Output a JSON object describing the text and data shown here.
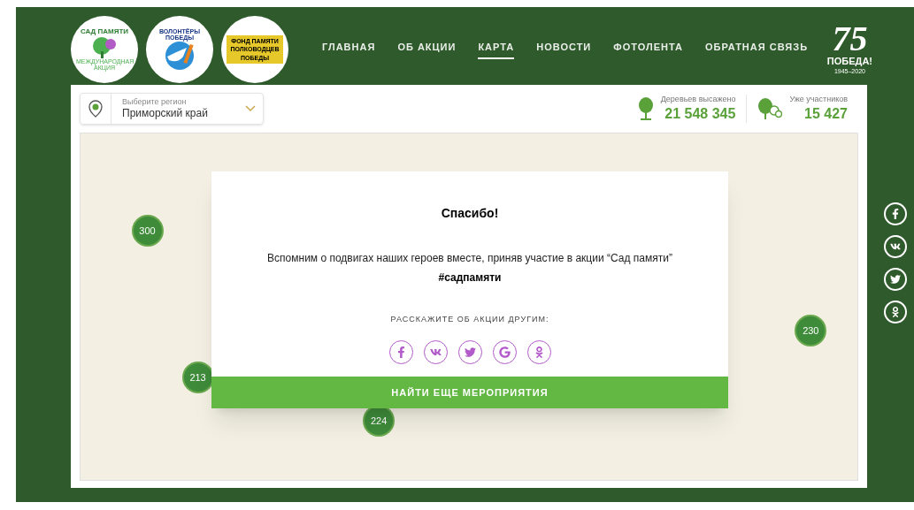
{
  "logos": [
    {
      "kind": "garden",
      "title": "САД ПАМЯТИ",
      "subtitle": "МЕЖДУНАРОДНАЯ АКЦИЯ"
    },
    {
      "kind": "volunteers",
      "title": "ВОЛОНТЁРЫ ПОБЕДЫ"
    },
    {
      "kind": "fund",
      "title": "ФОНД ПАМЯТИ ПОЛКОВОДЦЕВ ПОБЕДЫ"
    }
  ],
  "nav": [
    {
      "label": "ГЛАВНАЯ",
      "selected": false
    },
    {
      "label": "ОБ АКЦИИ",
      "selected": false
    },
    {
      "label": "КАРТА",
      "selected": true
    },
    {
      "label": "НОВОСТИ",
      "selected": false
    },
    {
      "label": "ФОТОЛЕНТА",
      "selected": false
    },
    {
      "label": "ОБРАТНАЯ СВЯЗЬ",
      "selected": false
    }
  ],
  "anniversary": {
    "number": "75",
    "title": "ПОБЕДА!",
    "years": "1945–2020"
  },
  "region": {
    "label": "Выберите регион",
    "value": "Приморский край"
  },
  "stats": [
    {
      "kind": "tree",
      "label": "Деревьев высажено",
      "value": "21 548 345"
    },
    {
      "kind": "people",
      "label": "Уже участников",
      "value": "15 427"
    }
  ],
  "clusters": [
    {
      "count": "300"
    },
    {
      "count": "213"
    },
    {
      "count": "224"
    },
    {
      "count": "230"
    }
  ],
  "modal": {
    "title": "Спасибо!",
    "text": "Вспомним о подвигах наших героев вместе, приняв участие в акции “Сад памяти”",
    "hashtag": "#садпамяти",
    "share_label": "РАССКАЖИТЕ ОБ АКЦИИ ДРУГИМ:",
    "share": [
      {
        "kind": "facebook"
      },
      {
        "kind": "vk"
      },
      {
        "kind": "twitter"
      },
      {
        "kind": "google"
      },
      {
        "kind": "ok"
      }
    ],
    "button": "НАЙТИ ЕЩЕ МЕРОПРИЯТИЯ"
  },
  "side_social": [
    {
      "kind": "facebook"
    },
    {
      "kind": "vk"
    },
    {
      "kind": "twitter"
    },
    {
      "kind": "ok"
    }
  ]
}
